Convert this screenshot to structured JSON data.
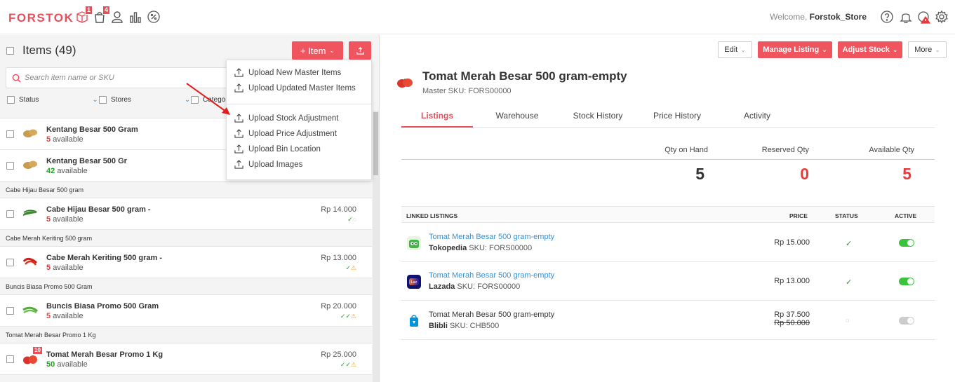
{
  "topbar": {
    "logo": "FORSTOK",
    "icons": [
      {
        "name": "box-icon",
        "badge": "1"
      },
      {
        "name": "bag-icon",
        "badge": "4"
      },
      {
        "name": "user-icon",
        "badge": ""
      },
      {
        "name": "chart-icon",
        "badge": ""
      },
      {
        "name": "discount-icon",
        "badge": ""
      }
    ],
    "welcome_prefix": "Welcome,",
    "store_name": "Forstok_Store",
    "right_icons": [
      "help-icon",
      "bell-icon",
      "alert-icon",
      "settings-icon"
    ]
  },
  "left": {
    "title": "Items (49)",
    "add_button": "+ Item",
    "search_placeholder": "Search item name or SKU",
    "filters": {
      "status": "Status",
      "stores": "Stores",
      "category": "Categor"
    },
    "partial_row": {
      "name": "Kentang Besar 500 Gram",
      "available_count": "5",
      "available_label": "available"
    },
    "rows": [
      {
        "type": "item",
        "name": "Kentang Besar 500 Gr",
        "available_count": "42",
        "available_label": "available",
        "count_color": "green",
        "price": "",
        "status": "",
        "thumb": "potato"
      },
      {
        "type": "group",
        "label": "Cabe Hijau Besar 500 gram"
      },
      {
        "type": "item",
        "name": "Cabe Hijau Besar 500 gram -",
        "available_count": "5",
        "available_label": "available",
        "count_color": "red",
        "price": "Rp 14.000",
        "status": "✓◌",
        "thumb": "green-chili"
      },
      {
        "type": "group",
        "label": "Cabe Merah Keriting 500 gram"
      },
      {
        "type": "item",
        "name": "Cabe Merah Keriting 500 gram -",
        "available_count": "5",
        "available_label": "available",
        "count_color": "red",
        "price": "Rp 13.000",
        "status": "✓⚠",
        "thumb": "red-chili"
      },
      {
        "type": "group",
        "label": "Buncis Biasa Promo 500 Gram"
      },
      {
        "type": "item",
        "name": "Buncis Biasa Promo 500 Gram",
        "available_count": "5",
        "available_label": "available",
        "count_color": "red",
        "price": "Rp 20.000",
        "status": "✓✓⚠",
        "thumb": "beans"
      },
      {
        "type": "group",
        "label": "Tomat Merah Besar Promo 1 Kg"
      },
      {
        "type": "item",
        "name": "Tomat Merah Besar Promo 1 Kg",
        "available_count": "50",
        "available_label": "available",
        "count_color": "green",
        "price": "Rp 25.000",
        "status": "✓✓⚠",
        "thumb": "tomato",
        "thumb_badge": "10"
      }
    ]
  },
  "dropdown": {
    "group1": [
      "Upload New Master Items",
      "Upload Updated Master Items"
    ],
    "group2": [
      "Upload Stock Adjustment",
      "Upload Price Adjustment",
      "Upload Bin Location",
      "Upload Images"
    ]
  },
  "right": {
    "buttons": {
      "edit": "Edit",
      "manage_listing": "Manage Listing",
      "adjust_stock": "Adjust Stock",
      "more": "More"
    },
    "product_title": "Tomat Merah Besar 500 gram-empty",
    "master_sku": "Master SKU: FORS00000",
    "tabs": [
      "Listings",
      "Warehouse",
      "Stock History",
      "Price History",
      "Activity"
    ],
    "qty": {
      "on_hand_label": "Qty on Hand",
      "on_hand": "5",
      "reserved_label": "Reserved Qty",
      "reserved": "0",
      "available_label": "Available Qty",
      "available": "5"
    },
    "linked_header": {
      "title": "LINKED LISTINGS",
      "price": "PRICE",
      "status": "STATUS",
      "active": "ACTIVE"
    },
    "listings": [
      {
        "name": "Tomat Merah Besar 500 gram-empty",
        "channel": "Tokopedia",
        "sku": "SKU: FORS00000",
        "price": "Rp  15.000",
        "old_price": "",
        "status": "✓",
        "active": true,
        "linked": true
      },
      {
        "name": "Tomat Merah Besar 500 gram-empty",
        "channel": "Lazada",
        "sku": "SKU: FORS00000",
        "price": "Rp  13.000",
        "old_price": "",
        "status": "✓",
        "active": true,
        "linked": true
      },
      {
        "name": "Tomat Merah Besar 500 gram-empty",
        "channel": "Blibli",
        "sku": "SKU: CHB500",
        "price": "Rp 37.500",
        "old_price": "Rp  50.000",
        "status": "◌",
        "active": false,
        "linked": false
      }
    ]
  },
  "colors": {
    "brand": "#e94f5b",
    "green": "#2a9d2a",
    "red_text": "#e83b3b",
    "toggle_on": "#3cc33c"
  }
}
